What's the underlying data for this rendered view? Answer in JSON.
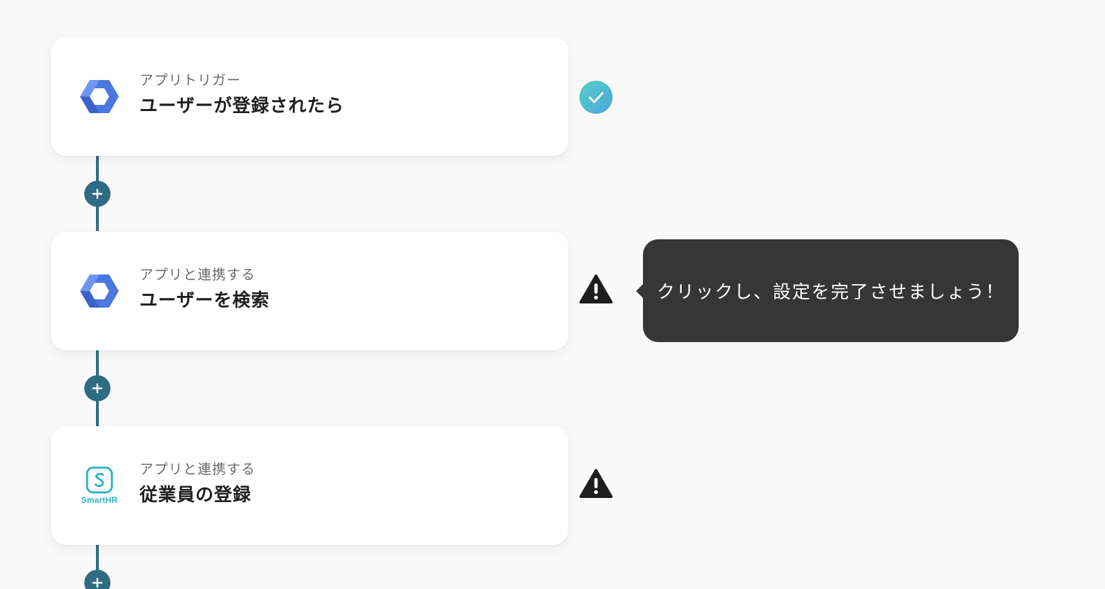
{
  "colors": {
    "background": "#f9f9f9",
    "connector": "#2d6c83",
    "success": "#4cc3cf",
    "warning": "#1e1e1e",
    "tooltip_bg": "#363636",
    "workspace_blue": "#4a78e0",
    "smarthr_teal": "#2db3c5"
  },
  "steps": [
    {
      "app_icon": "google-workspace-icon",
      "subtitle": "アプリトリガー",
      "title": "ユーザーが登録されたら",
      "status": "success-check-icon"
    },
    {
      "app_icon": "google-workspace-icon",
      "subtitle": "アプリと連携する",
      "title": "ユーザーを検索",
      "status": "warning-icon"
    },
    {
      "app_icon": "smarthr-icon",
      "app_icon_label": "SmartHR",
      "subtitle": "アプリと連携する",
      "title": "従業員の登録",
      "status": "warning-icon"
    }
  ],
  "add_button_icon": "plus-icon",
  "tooltip": {
    "text": "クリックし、設定を完了させましょう！"
  }
}
